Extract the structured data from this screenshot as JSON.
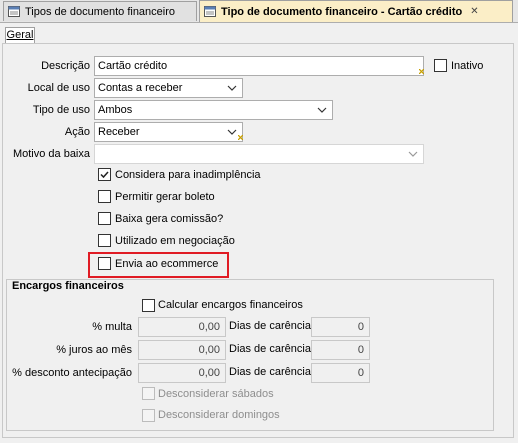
{
  "tabs": [
    {
      "label": "Tipos de documento financeiro"
    },
    {
      "label": "Tipo de documento financeiro - Cartão crédito"
    }
  ],
  "subtab": {
    "label": "Geral"
  },
  "form": {
    "descricao": {
      "label": "Descrição",
      "value": "Cartão crédito"
    },
    "inativo": {
      "label": "Inativo",
      "checked": false
    },
    "local_uso": {
      "label": "Local de uso",
      "value": "Contas a receber"
    },
    "tipo_uso": {
      "label": "Tipo de uso",
      "value": "Ambos"
    },
    "acao": {
      "label": "Ação",
      "value": "Receber"
    },
    "motivo_baixa": {
      "label": "Motivo da baixa",
      "value": ""
    },
    "checkboxes": [
      {
        "label": "Considera para inadimplência",
        "checked": true
      },
      {
        "label": "Permitir gerar boleto",
        "checked": false
      },
      {
        "label": "Baixa gera comissão?",
        "checked": false
      },
      {
        "label": "Utilizado em negociação",
        "checked": false
      },
      {
        "label": "Envia ao ecommerce",
        "checked": false
      }
    ]
  },
  "encargos": {
    "title": "Encargos financeiros",
    "calcular": {
      "label": "Calcular encargos financeiros",
      "checked": false
    },
    "rows": [
      {
        "label": "% multa",
        "value": "0,00",
        "dias_label": "Dias de carência",
        "dias_value": "0"
      },
      {
        "label": "% juros ao mês",
        "value": "0,00",
        "dias_label": "Dias de carência",
        "dias_value": "0"
      },
      {
        "label": "% desconto antecipação",
        "value": "0,00",
        "dias_label": "Dias de carência",
        "dias_value": "0"
      }
    ],
    "desconsiderar_sabados": {
      "label": "Desconsiderar sábados",
      "checked": false
    },
    "desconsiderar_domingos": {
      "label": "Desconsiderar domingos",
      "checked": false
    }
  },
  "colors": {
    "active_tab": "#fbeec7",
    "highlight": "#e01b24",
    "required_marker": "#c8a000"
  },
  "icons": [
    "document-tab-icon",
    "document-tab-icon",
    "close-icon",
    "chevron-down-icon",
    "check-icon",
    "required-marker-icon"
  ]
}
